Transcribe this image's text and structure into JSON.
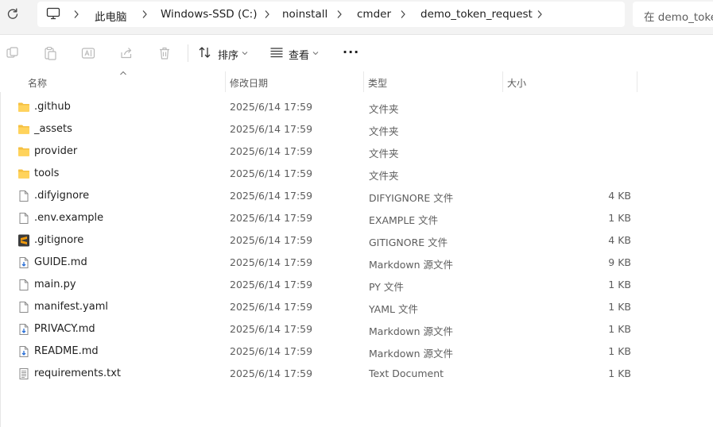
{
  "address_bar": {
    "breadcrumbs": [
      "此电脑",
      "Windows-SSD (C:)",
      "noinstall",
      "cmder",
      "demo_token_request"
    ],
    "search_placeholder": "在 demo_token_request 中搜索"
  },
  "toolbar": {
    "sort_label": "排序",
    "view_label": "查看",
    "more_label": "···"
  },
  "columns": {
    "name": "名称",
    "date": "修改日期",
    "type": "类型",
    "size": "大小"
  },
  "files": [
    {
      "name": ".github",
      "date": "2025/6/14 17:59",
      "type": "文件夹",
      "size": "",
      "icon": "folder-icon"
    },
    {
      "name": "_assets",
      "date": "2025/6/14 17:59",
      "type": "文件夹",
      "size": "",
      "icon": "folder-icon"
    },
    {
      "name": "provider",
      "date": "2025/6/14 17:59",
      "type": "文件夹",
      "size": "",
      "icon": "folder-icon"
    },
    {
      "name": "tools",
      "date": "2025/6/14 17:59",
      "type": "文件夹",
      "size": "",
      "icon": "folder-icon"
    },
    {
      "name": ".difyignore",
      "date": "2025/6/14 17:59",
      "type": "DIFYIGNORE 文件",
      "size": "4 KB",
      "icon": "file-icon"
    },
    {
      "name": ".env.example",
      "date": "2025/6/14 17:59",
      "type": "EXAMPLE 文件",
      "size": "1 KB",
      "icon": "file-icon"
    },
    {
      "name": ".gitignore",
      "date": "2025/6/14 17:59",
      "type": "GITIGNORE 文件",
      "size": "4 KB",
      "icon": "sublime-file-icon"
    },
    {
      "name": "GUIDE.md",
      "date": "2025/6/14 17:59",
      "type": "Markdown 源文件",
      "size": "9 KB",
      "icon": "markdown-file-icon"
    },
    {
      "name": "main.py",
      "date": "2025/6/14 17:59",
      "type": "PY 文件",
      "size": "1 KB",
      "icon": "file-icon"
    },
    {
      "name": "manifest.yaml",
      "date": "2025/6/14 17:59",
      "type": "YAML 文件",
      "size": "1 KB",
      "icon": "file-icon"
    },
    {
      "name": "PRIVACY.md",
      "date": "2025/6/14 17:59",
      "type": "Markdown 源文件",
      "size": "1 KB",
      "icon": "markdown-file-icon"
    },
    {
      "name": "README.md",
      "date": "2025/6/14 17:59",
      "type": "Markdown 源文件",
      "size": "1 KB",
      "icon": "markdown-file-icon"
    },
    {
      "name": "requirements.txt",
      "date": "2025/6/14 17:59",
      "type": "Text Document",
      "size": "1 KB",
      "icon": "text-file-icon"
    }
  ],
  "colors": {
    "folder": "#f5c042",
    "accent": "#0067c0",
    "sublime": "#f29b0c"
  }
}
